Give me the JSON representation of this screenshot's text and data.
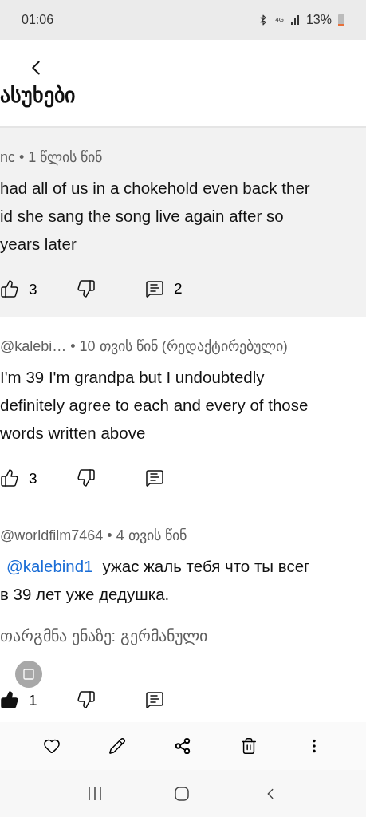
{
  "status_bar": {
    "time": "01:06",
    "battery": "13%",
    "network": "4G"
  },
  "header": {
    "title": "ასუხები"
  },
  "comments": [
    {
      "meta": "nc • 1 წლის წინ",
      "lines": [
        "had all of us in a chokehold even back ther",
        "id she sang the song live again after so",
        "years later"
      ],
      "highlighted": true,
      "liked": false,
      "likes": "3",
      "replies": "2"
    },
    {
      "meta": "@kalebi…  • 10 თვის წინ (რედაქტირებული)",
      "lines": [
        "I'm 39 I'm grandpa but I undoubtedly",
        "definitely agree to each and every of those",
        "words written above"
      ],
      "liked": false,
      "likes": "3"
    },
    {
      "meta": "@worldfilm7464 • 4 თვის წინ",
      "mention": "@kalebind1",
      "lines": [
        "ужас жаль тебя что ты всег",
        "в 39 лет уже дедушка."
      ],
      "liked": true,
      "likes": "1",
      "translate": "თარგმნა ენაზე: გერმანული"
    }
  ]
}
